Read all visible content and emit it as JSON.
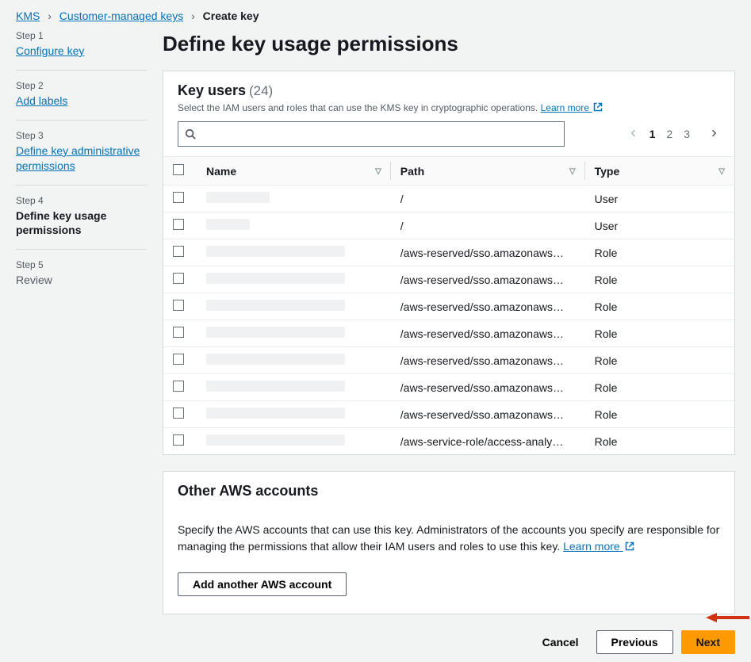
{
  "breadcrumb": {
    "root": "KMS",
    "mid": "Customer-managed keys",
    "current": "Create key"
  },
  "sidebar": {
    "steps": [
      {
        "label": "Step 1",
        "title": "Configure key",
        "state": "link"
      },
      {
        "label": "Step 2",
        "title": "Add labels",
        "state": "link"
      },
      {
        "label": "Step 3",
        "title": "Define key administrative permissions",
        "state": "link"
      },
      {
        "label": "Step 4",
        "title": "Define key usage permissions",
        "state": "active"
      },
      {
        "label": "Step 5",
        "title": "Review",
        "state": "future"
      }
    ]
  },
  "pageTitle": "Define key usage permissions",
  "keyUsers": {
    "title": "Key users",
    "count": "(24)",
    "desc": "Select the IAM users and roles that can use the KMS key in cryptographic operations.",
    "learnMore": "Learn more",
    "searchPlaceholder": "",
    "pagination": {
      "pages": [
        "1",
        "2",
        "3"
      ],
      "current": 1
    },
    "columns": {
      "name": "Name",
      "path": "Path",
      "type": "Type"
    },
    "rows": [
      {
        "nameWidth": 80,
        "path": "/",
        "type": "User"
      },
      {
        "nameWidth": 55,
        "path": "/",
        "type": "User"
      },
      {
        "nameWidth": 175,
        "path": "/aws-reserved/sso.amazonaws…",
        "type": "Role"
      },
      {
        "nameWidth": 175,
        "path": "/aws-reserved/sso.amazonaws…",
        "type": "Role"
      },
      {
        "nameWidth": 175,
        "path": "/aws-reserved/sso.amazonaws…",
        "type": "Role"
      },
      {
        "nameWidth": 175,
        "path": "/aws-reserved/sso.amazonaws…",
        "type": "Role"
      },
      {
        "nameWidth": 175,
        "path": "/aws-reserved/sso.amazonaws…",
        "type": "Role"
      },
      {
        "nameWidth": 175,
        "path": "/aws-reserved/sso.amazonaws…",
        "type": "Role"
      },
      {
        "nameWidth": 175,
        "path": "/aws-reserved/sso.amazonaws…",
        "type": "Role"
      },
      {
        "nameWidth": 175,
        "path": "/aws-service-role/access-analy…",
        "type": "Role"
      }
    ]
  },
  "other": {
    "title": "Other AWS accounts",
    "desc": "Specify the AWS accounts that can use this key. Administrators of the accounts you specify are responsible for managing the permissions that allow their IAM users and roles to use this key.",
    "learnMore": "Learn more",
    "addBtn": "Add another AWS account"
  },
  "footer": {
    "cancel": "Cancel",
    "previous": "Previous",
    "next": "Next"
  }
}
